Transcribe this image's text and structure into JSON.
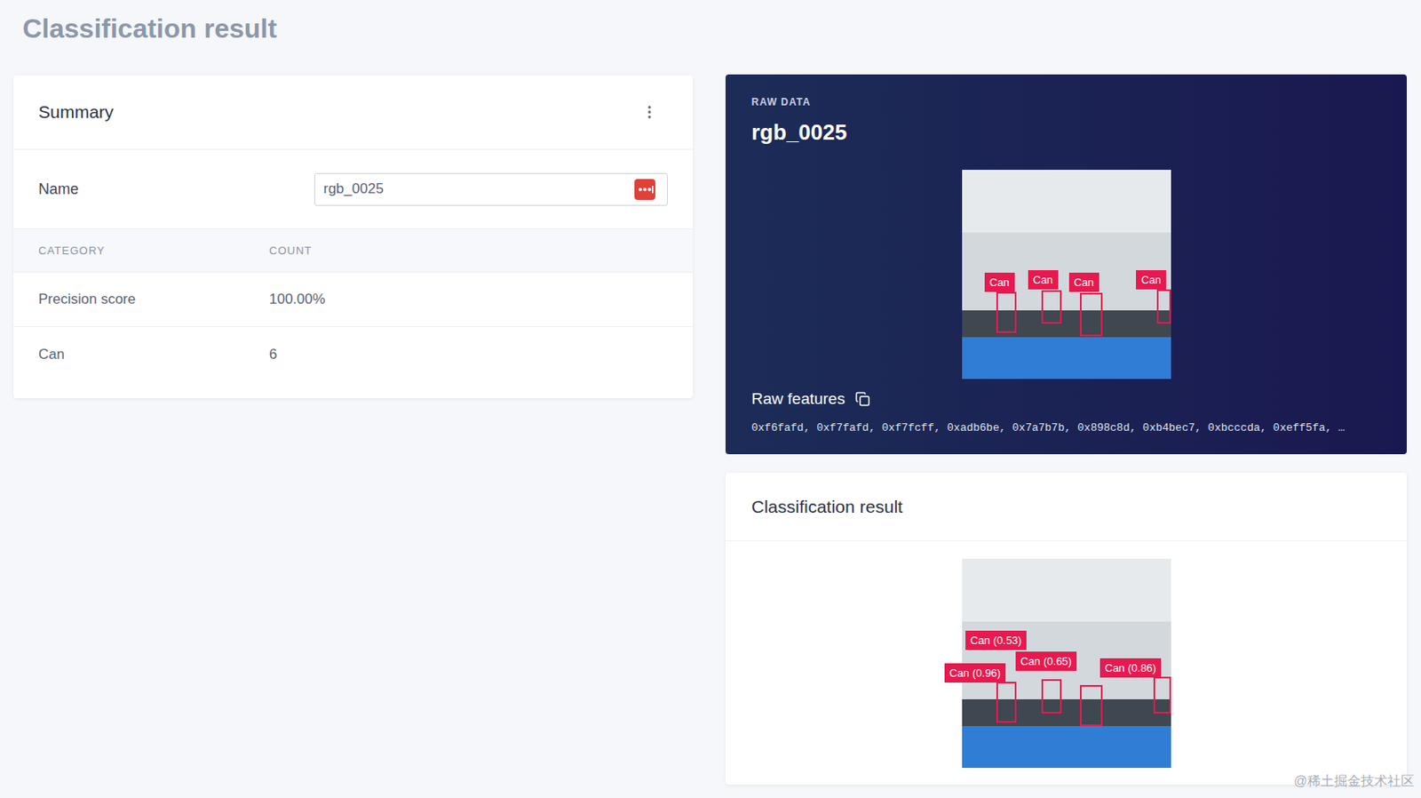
{
  "page": {
    "title": "Classification result"
  },
  "summary": {
    "title": "Summary"
  },
  "name_field": {
    "label": "Name",
    "value": "rgb_0025"
  },
  "table": {
    "columns": [
      "CATEGORY",
      "COUNT"
    ],
    "rows": [
      {
        "category": "Precision score",
        "count": "100.00%"
      },
      {
        "category": "Can",
        "count": "6"
      }
    ]
  },
  "raw_data": {
    "eyebrow": "RAW DATA",
    "title": "rgb_0025",
    "features_label": "Raw features",
    "features": "0xf6fafd, 0xf7fafd, 0xf7fcff, 0xadb6be, 0x7a7b7b, 0x898c8d, 0xb4bec7, 0xbcccda, 0xeff5fa, …",
    "boxes": [
      {
        "label": "Can",
        "box": [
          0.165,
          0.583,
          0.096,
          0.196
        ],
        "tag": [
          0.109,
          0.491
        ]
      },
      {
        "label": "Can",
        "box": [
          0.383,
          0.574,
          0.096,
          0.161
        ],
        "tag": [
          0.317,
          0.478
        ]
      },
      {
        "label": "Can",
        "box": [
          0.565,
          0.587,
          0.109,
          0.209
        ],
        "tag": [
          0.513,
          0.491
        ]
      },
      {
        "label": "Can",
        "box": [
          0.935,
          0.57,
          0.065,
          0.165
        ],
        "tag": [
          0.835,
          0.478
        ]
      }
    ]
  },
  "result": {
    "title": "Classification result",
    "boxes": [
      [
        0.165,
        0.587,
        0.096,
        0.196
      ],
      [
        0.383,
        0.574,
        0.096,
        0.165
      ],
      [
        0.565,
        0.604,
        0.109,
        0.196
      ],
      [
        0.917,
        0.565,
        0.083,
        0.174
      ]
    ],
    "labels": [
      {
        "text": "Can (0.53)",
        "at": [
          0.017,
          0.343
        ]
      },
      {
        "text": "Can (0.65)",
        "at": [
          0.257,
          0.443
        ]
      },
      {
        "text": "Can (0.96)",
        "at": [
          -0.083,
          0.5
        ]
      },
      {
        "text": "Can (0.86)",
        "at": [
          0.661,
          0.474
        ]
      }
    ]
  },
  "watermark": "@稀土掘金技术社区"
}
